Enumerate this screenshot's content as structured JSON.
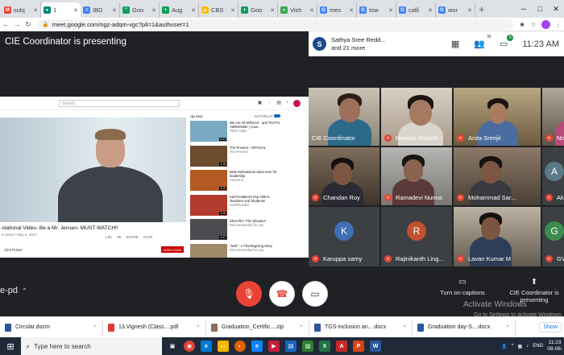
{
  "browser": {
    "tabs": [
      {
        "label": "subj",
        "icon": "gmail-icon",
        "color": "#ea4335",
        "glyph": "M"
      },
      {
        "label": "1",
        "icon": "meet-icon",
        "color": "#00897b",
        "glyph": "●",
        "active": true
      },
      {
        "label": "IBD",
        "icon": "docs-icon",
        "color": "#4285f4",
        "glyph": "≡"
      },
      {
        "label": "Goo",
        "icon": "hangouts-icon",
        "color": "#0f9d58",
        "glyph": "\""
      },
      {
        "label": "Aug",
        "icon": "sheets-icon",
        "color": "#0f9d58",
        "glyph": "+"
      },
      {
        "label": "CBS",
        "icon": "drive-icon",
        "color": "#fbbc04",
        "glyph": "▲"
      },
      {
        "label": "Goo",
        "icon": "sheets-icon",
        "color": "#0f9d58",
        "glyph": "+"
      },
      {
        "label": "Vish",
        "icon": "wifi-icon",
        "color": "#34a853",
        "glyph": "≈"
      },
      {
        "label": "mes",
        "icon": "google-icon",
        "color": "#4285f4",
        "glyph": "G"
      },
      {
        "label": "tow",
        "icon": "google-icon",
        "color": "#4285f4",
        "glyph": "G"
      },
      {
        "label": "calli",
        "icon": "google-icon",
        "color": "#4285f4",
        "glyph": "G"
      },
      {
        "label": "wor",
        "icon": "google-icon",
        "color": "#4285f4",
        "glyph": "G"
      }
    ],
    "new_tab": "+",
    "url": "meet.google.com/ngz-adqm-vgc?pli=1&authuser=1"
  },
  "meet": {
    "presenting_title": "CIE Coordinator is presenting",
    "speaker_initial": "S",
    "speaker_name": "Sathya Sree Redd...",
    "speaker_more": "and 21 more",
    "people_count": "36",
    "chat_count": "6",
    "time": "11:23 AM",
    "meeting_code": "e-pd",
    "captions_label": "Turn on captions",
    "present_label": "CIE Coordinator is presenting",
    "watermark": "Activate Windows",
    "watermark_sub": "Go to Settings to activate Windows."
  },
  "shared_screen": {
    "search_placeholder": "Search",
    "video_title": "otational Video- Be a Mr. Jensen- MUST WATCH!!",
    "video_views": "0 views • May 4, 2017",
    "actions": [
      "1.9K",
      "66",
      "SHARE",
      "SAVE"
    ],
    "channel": "Clint Pulver",
    "subscribe": "SUBSCRIBE",
    "up_next": "Up next",
    "autoplay": "AUTOPLAY",
    "suggestions": [
      {
        "title": "We Are All Different - and THAT'S AWESOME! | Cam...",
        "sub": "TEDx Talks",
        "duration": "6:43",
        "color": "#7aa9c4"
      },
      {
        "title": "The Present - OFFICIAL",
        "sub": "The Present",
        "duration": "4:18",
        "color": "#6d4b2e"
      },
      {
        "title": "Best motivational video ever for leadership",
        "sub": "Ameen G",
        "duration": "3:15",
        "color": "#b35a22"
      },
      {
        "title": "Kid President's Pep Talk to Teachers and Students!",
        "sub": "SoulPancake",
        "duration": "3:26",
        "color": "#b23b2e"
      },
      {
        "title": "Short film \"The Elevator\"",
        "sub": "Recommended for you",
        "duration": "4:41",
        "color": "#4b4b50"
      },
      {
        "title": "\"Salt\" - A Thanksgiving Story",
        "sub": "Recommended for you",
        "duration": "6:54",
        "color": "#a08a6a"
      }
    ]
  },
  "participants": [
    {
      "name": "CIE Coordinator",
      "muted": false
    },
    {
      "name": "Nandita Maunth...",
      "muted": true
    },
    {
      "name": "Anita Sreejit",
      "muted": true
    },
    {
      "name": "Nisha",
      "muted": true
    },
    {
      "name": "Chandan Roy",
      "muted": true
    },
    {
      "name": "Ramadevi Nunna",
      "muted": true
    },
    {
      "name": "Mohammad Sar...",
      "muted": true
    },
    {
      "name": "Akanks",
      "muted": true,
      "initial": "A",
      "color": "#5a7a8a"
    },
    {
      "name": "Karuppa samy",
      "muted": true,
      "initial": "K",
      "color": "#3f6fb5"
    },
    {
      "name": "Rajinikanth Ling...",
      "muted": true,
      "initial": "R",
      "color": "#c1502e"
    },
    {
      "name": "Lavan Kumar M",
      "muted": true
    },
    {
      "name": "GVRS",
      "muted": true,
      "initial": "G",
      "color": "#3c8d4f"
    }
  ],
  "downloads": [
    {
      "name": "Circular.docm",
      "color": "#2b579a"
    },
    {
      "name": "13.Vignesh (Class....pdf",
      "color": "#e53935"
    },
    {
      "name": "Graduation_Certific....zip",
      "color": "#8d6e63"
    },
    {
      "name": "TGS-inclusion an....docx",
      "color": "#2b579a"
    },
    {
      "name": "Graduation day-S....docx",
      "color": "#2b579a"
    }
  ],
  "show_all": "Show",
  "taskbar": {
    "search_text": "Type here to search",
    "lang": "ENG",
    "time": "11:23",
    "date": "08-08-"
  }
}
